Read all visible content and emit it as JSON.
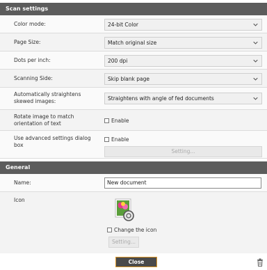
{
  "scan_settings": {
    "header": "Scan settings",
    "color_mode": {
      "label": "Color mode:",
      "value": "24-bit Color"
    },
    "page_size": {
      "label": "Page Size:",
      "value": "Match original size"
    },
    "dpi": {
      "label": "Dots per inch:",
      "value": "200 dpi"
    },
    "scanning_side": {
      "label": "Scanning Side:",
      "value": "Skip blank page"
    },
    "straighten": {
      "label": "Automatically straightens skewed images:",
      "value": "Straightens with angle of fed documents"
    },
    "rotate": {
      "label": "Rotate image to match orientation of text",
      "checkbox_label": "Enable"
    },
    "advanced": {
      "label": "Use advanced settings dialog box",
      "checkbox_label": "Enable",
      "button_label": "Setting..."
    }
  },
  "general": {
    "header": "General",
    "name": {
      "label": "Name:",
      "value": "New document"
    },
    "icon": {
      "label": "Icon",
      "change_label": "Change the icon",
      "button_label": "Setting..."
    }
  },
  "footer": {
    "close_label": "Close"
  },
  "icons": {
    "dropdown": "chevron-down-icon",
    "delete": "trash-icon",
    "document": "document-flower-icon"
  }
}
